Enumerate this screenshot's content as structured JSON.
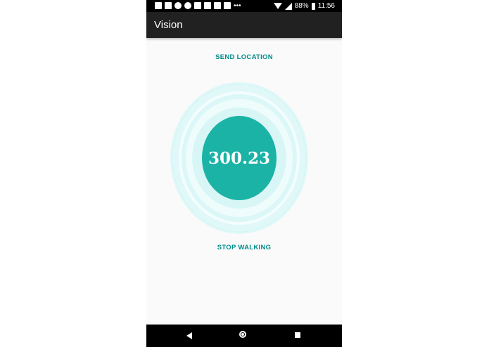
{
  "status_bar": {
    "battery": "88%",
    "time": "11:56",
    "icons": [
      "facebook-icon",
      "facebook-icon",
      "whatsapp-icon",
      "pinterest-icon",
      "gmail-icon",
      "dropbox-icon",
      "gmail-icon",
      "message-icon",
      "more-icon",
      "wifi-icon",
      "signal-icon",
      "battery-icon"
    ]
  },
  "app_bar": {
    "title": "Vision"
  },
  "main": {
    "send_location_label": "SEND LOCATION",
    "counter_value": "300.23",
    "stop_walking_label": "STOP WALKING"
  },
  "nav_bar": {
    "icons": [
      "back-icon",
      "home-icon",
      "recents-icon"
    ]
  },
  "colors": {
    "accent": "#00897b",
    "circle": "#1ab3a6",
    "ring": "#d6f6f6",
    "app_bar": "#212121",
    "background": "#fafafa"
  }
}
